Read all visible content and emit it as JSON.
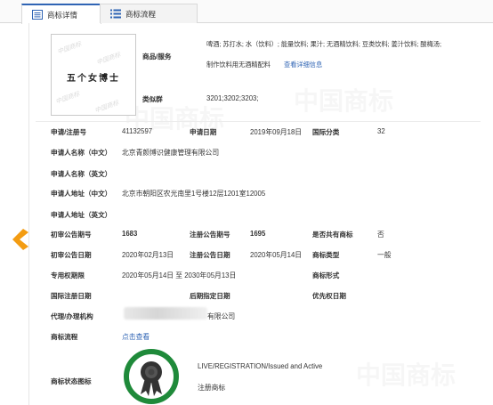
{
  "tabs": [
    {
      "label": "商标详情",
      "icon": "detail-list-icon",
      "active": true
    },
    {
      "label": "商标流程",
      "icon": "flow-list-icon",
      "active": false
    }
  ],
  "trademark": {
    "image_text": "五个女博士",
    "image_watermark": "中国商标"
  },
  "goods": {
    "label": "商品/服务",
    "line1": "啤酒; 苏打水; 水（饮料）; 能量饮料; 果汁; 无酒精饮料; 豆类饮料; 姜汁饮料; 酸梅汤;",
    "line2": "制作饮料用无酒精配料",
    "detail_link": "查看详细信息"
  },
  "similar_group": {
    "label": "类似群",
    "value": "3201;3202;3203;"
  },
  "fields": {
    "reg_no": {
      "label": "申请/注册号",
      "value": "41132597"
    },
    "app_date": {
      "label": "申请日期",
      "value": "2019年09月18日"
    },
    "intl_class": {
      "label": "国际分类",
      "value": "32"
    },
    "applicant_cn": {
      "label": "申请人名称（中文）",
      "value": "北京青颜博识健康管理有限公司"
    },
    "applicant_en": {
      "label": "申请人名称（英文）",
      "value": ""
    },
    "address_cn": {
      "label": "申请人地址（中文）",
      "value": "北京市朝阳区农光南里1号楼12层1201室12005"
    },
    "address_en": {
      "label": "申请人地址（英文）",
      "value": ""
    },
    "prelim_no": {
      "label": "初审公告期号",
      "value": "1683"
    },
    "reg_pub_no": {
      "label": "注册公告期号",
      "value": "1695"
    },
    "shared": {
      "label": "是否共有商标",
      "value": "否"
    },
    "prelim_date": {
      "label": "初审公告日期",
      "value": "2020年02月13日"
    },
    "reg_pub_date": {
      "label": "注册公告日期",
      "value": "2020年05月14日"
    },
    "tm_type": {
      "label": "商标类型",
      "value": "一般"
    },
    "exclusive": {
      "label": "专用权期限",
      "value": "2020年05月14日 至 2030年05月13日"
    },
    "tm_form": {
      "label": "商标形式",
      "value": ""
    },
    "intl_reg_date": {
      "label": "国际注册日期",
      "value": ""
    },
    "later_date": {
      "label": "后期指定日期",
      "value": ""
    },
    "priority_date": {
      "label": "优先权日期",
      "value": ""
    },
    "agent": {
      "label": "代理/办理机构",
      "value": "有限公司"
    },
    "process": {
      "label": "商标流程",
      "value": "点击查看"
    },
    "status_icon": {
      "label": "商标状态图标"
    }
  },
  "status": {
    "line1": "LIVE/REGISTRATION/Issued and Active",
    "line2": "注册商标",
    "badge_color": "#1f8a3a"
  },
  "colors": {
    "accent": "#2f64b4",
    "arrow": "#f39c12"
  },
  "icons": {
    "back": "chevron-left-icon",
    "badge": "registered-ribbon-icon"
  }
}
